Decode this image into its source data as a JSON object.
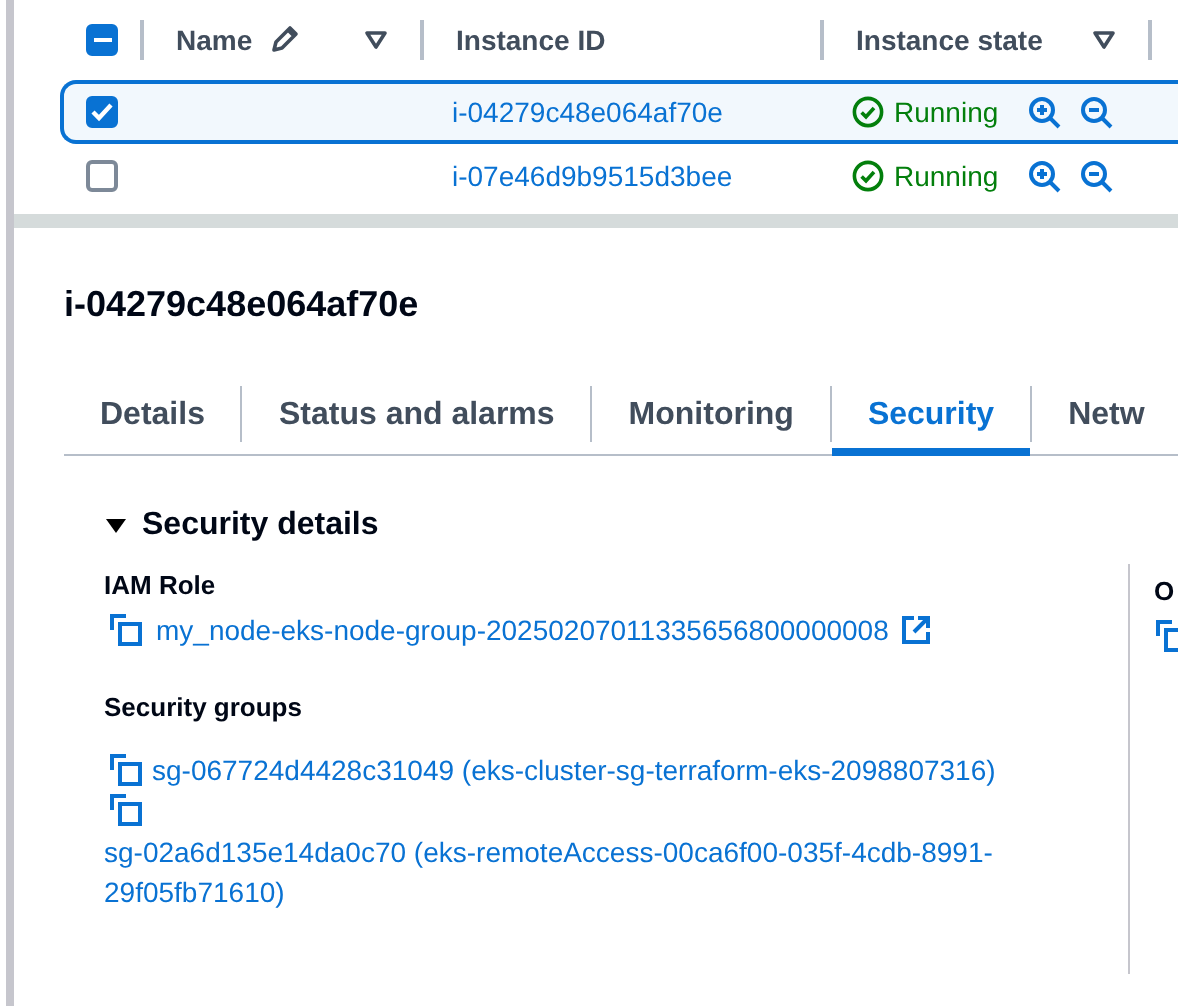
{
  "table": {
    "select_all": {
      "indeterminate": true
    },
    "columns": [
      {
        "label": "Name",
        "edit_icon": true,
        "filter_icon": true
      },
      {
        "label": "Instance ID",
        "edit_icon": false,
        "filter_icon": false
      },
      {
        "label": "Instance state",
        "edit_icon": false,
        "filter_icon": true
      }
    ],
    "rows": [
      {
        "selected": true,
        "instance_id": "i-04279c48e064af70e",
        "state": "Running",
        "kind": "running"
      },
      {
        "selected": false,
        "instance_id": "i-07e46d9b9515d3bee",
        "state": "Running",
        "kind": "running"
      }
    ]
  },
  "details": {
    "title": "i-04279c48e064af70e",
    "tabs": [
      {
        "label": "Details",
        "selected": false
      },
      {
        "label": "Status and alarms",
        "selected": false
      },
      {
        "label": "Monitoring",
        "selected": false
      },
      {
        "label": "Security",
        "selected": true
      },
      {
        "label": "Netw",
        "selected": false
      }
    ],
    "section": {
      "title": "Security details",
      "expanded": true,
      "iam_role": {
        "label": "IAM Role",
        "value": "my_node-eks-node-group-20250207011335656800000008"
      },
      "security_groups": {
        "label": "Security groups",
        "items": [
          "sg-067724d4428c31049 (eks-cluster-sg-terraform-eks-2098807316)",
          "sg-02a6d135e14da0c70 (eks-remoteAccess-00ca6f00-035f-4cdb-8991-29f05fb71610)"
        ]
      },
      "column_2": {
        "label": "O"
      }
    }
  }
}
